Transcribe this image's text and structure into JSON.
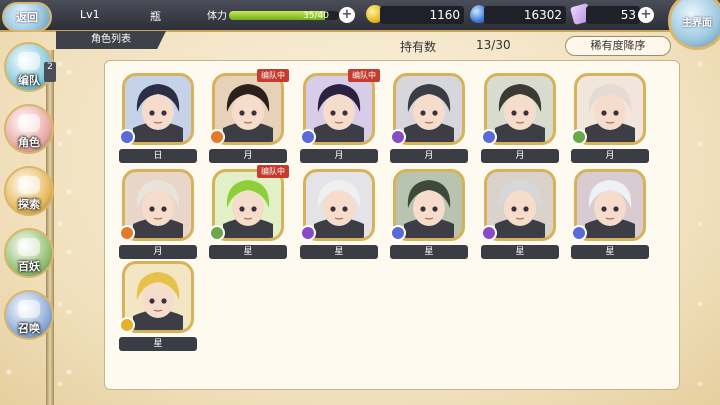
{
  "header": {
    "back_label": "返回",
    "level": "Lv1",
    "player_name": "瓶",
    "stamina_label": "体力",
    "stamina_value": "35/40",
    "stamina_fraction": 0.875,
    "gold": "1160",
    "gems": "16302",
    "tickets": "53",
    "home_label": "主界面"
  },
  "subheader": {
    "tab_title": "角色列表",
    "owned_label": "持有数",
    "owned_count": "13/30",
    "sort_label": "稀有度降序"
  },
  "sidebar": {
    "items": [
      {
        "label": "编队",
        "badge": "2",
        "color": "#7fc7d9"
      },
      {
        "label": "角色",
        "color": "#e8a6a0"
      },
      {
        "label": "探索",
        "color": "#e6b856"
      },
      {
        "label": "百妖",
        "color": "#8fbf6f"
      },
      {
        "label": "召唤",
        "color": "#89a9d6"
      }
    ]
  },
  "characters": [
    {
      "name": "日",
      "team_tag": "",
      "hair": "#2b2f45",
      "bg": "#c6d2e8",
      "element": "#5a6ad6"
    },
    {
      "name": "月",
      "team_tag": "编队中",
      "hair": "#2a211a",
      "bg": "#e6d2b8",
      "element": "#e67a2b"
    },
    {
      "name": "月",
      "team_tag": "编队中",
      "hair": "#2a2240",
      "bg": "#d8cde8",
      "element": "#5a6ad6"
    },
    {
      "name": "月",
      "team_tag": "",
      "hair": "#3a3d44",
      "bg": "#d6d6dc",
      "element": "#8a4ac6"
    },
    {
      "name": "月",
      "team_tag": "",
      "hair": "#3b3a33",
      "bg": "#d8dccf",
      "element": "#5a6ad6"
    },
    {
      "name": "月",
      "team_tag": "",
      "hair": "#e4dcd0",
      "bg": "#f0e6dc",
      "element": "#6aa84a"
    },
    {
      "name": "月",
      "team_tag": "",
      "hair": "#e8e4dc",
      "bg": "#e8d6c8",
      "element": "#e67a2b"
    },
    {
      "name": "星",
      "team_tag": "编队中",
      "hair": "#8ccf3a",
      "bg": "#e2f0c8",
      "element": "#6aa84a"
    },
    {
      "name": "星",
      "team_tag": "",
      "hair": "#f0f0f0",
      "bg": "#e4e4e8",
      "element": "#8a4ac6"
    },
    {
      "name": "星",
      "team_tag": "",
      "hair": "#3d4a3a",
      "bg": "#b8c4b0",
      "element": "#5a6ad6"
    },
    {
      "name": "星",
      "team_tag": "",
      "hair": "#d8d8dc",
      "bg": "#dcd2cc",
      "element": "#8a4ac6"
    },
    {
      "name": "星",
      "team_tag": "",
      "hair": "#eef2f4",
      "bg": "#d8ccd2",
      "element": "#5a6ad6"
    },
    {
      "name": "星",
      "team_tag": "",
      "hair": "#e6c24a",
      "bg": "#f2e6c4",
      "element": "#e6b22b"
    }
  ]
}
